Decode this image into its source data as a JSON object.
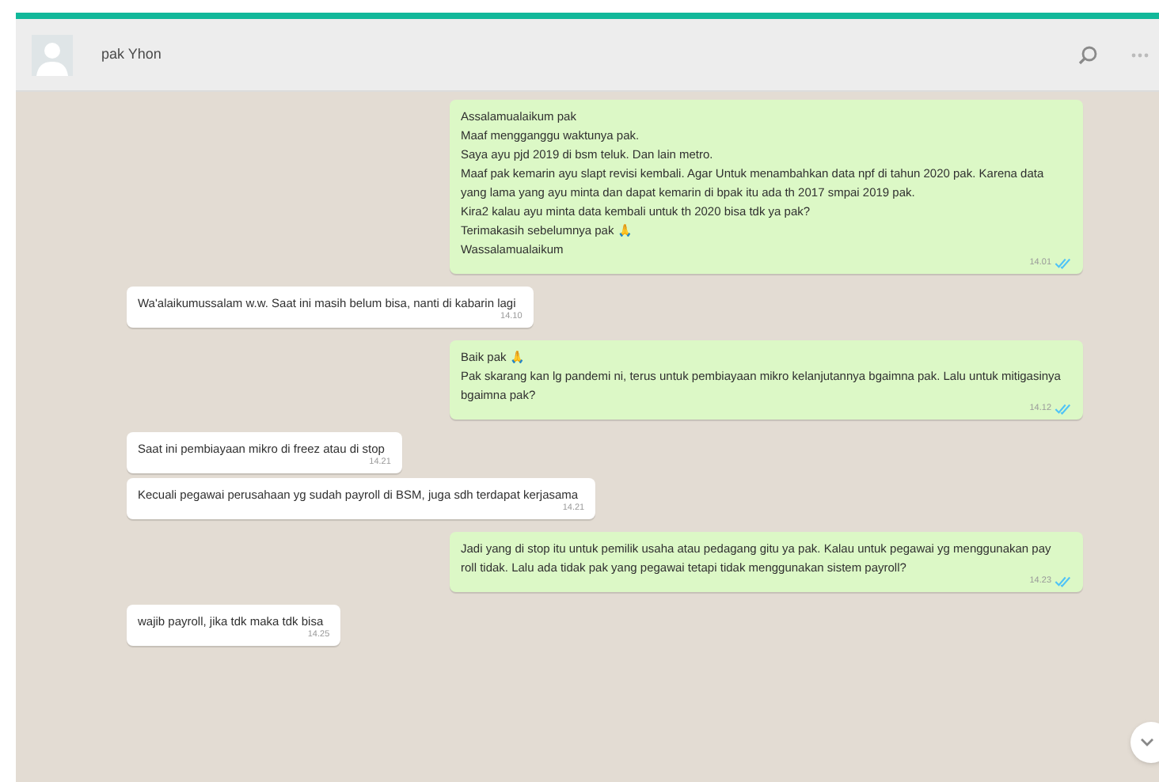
{
  "header": {
    "contact_name": "pak Yhon"
  },
  "messages": [
    {
      "kind": "outgoing",
      "text": "Assalamualaikum pak\nMaaf mengganggu waktunya pak.\nSaya ayu pjd 2019 di bsm teluk. Dan lain metro.\nMaaf pak kemarin ayu slapt revisi kembali. Agar Untuk menambahkan data npf di tahun 2020 pak. Karena data yang lama yang ayu minta dan dapat kemarin di bpak itu ada th 2017 smpai 2019 pak.\nKira2 kalau ayu minta data kembali untuk th 2020 bisa tdk ya pak?\nTerimakasih sebelumnya pak 🙏\nWassalamualaikum",
      "time": "14.01"
    },
    {
      "kind": "incoming",
      "text": "Wa'alaikumussalam w.w. Saat ini masih belum bisa, nanti di kabarin lagi",
      "time": "14.10"
    },
    {
      "kind": "outgoing",
      "text": "Baik pak 🙏\nPak skarang kan lg pandemi ni, terus untuk pembiayaan mikro kelanjutannya bgaimna pak. Lalu untuk mitigasinya bgaimna pak?",
      "time": "14.12"
    },
    {
      "kind": "incoming",
      "text": "Saat ini pembiayaan mikro di freez atau di stop",
      "time": "14.21"
    },
    {
      "kind": "incoming",
      "text": "Kecuali pegawai perusahaan yg sudah payroll di BSM, juga sdh terdapat kerjasama",
      "time": "14.21"
    },
    {
      "kind": "outgoing",
      "text": "Jadi yang di stop itu untuk pemilik usaha atau pedagang gitu ya pak. Kalau untuk pegawai yg menggunakan pay roll tidak. Lalu ada tidak pak yang pegawai tetapi tidak menggunakan sistem payroll?",
      "time": "14.23"
    },
    {
      "kind": "incoming",
      "text": "wajib payroll, jika tdk maka tdk bisa",
      "time": "14.25"
    }
  ]
}
